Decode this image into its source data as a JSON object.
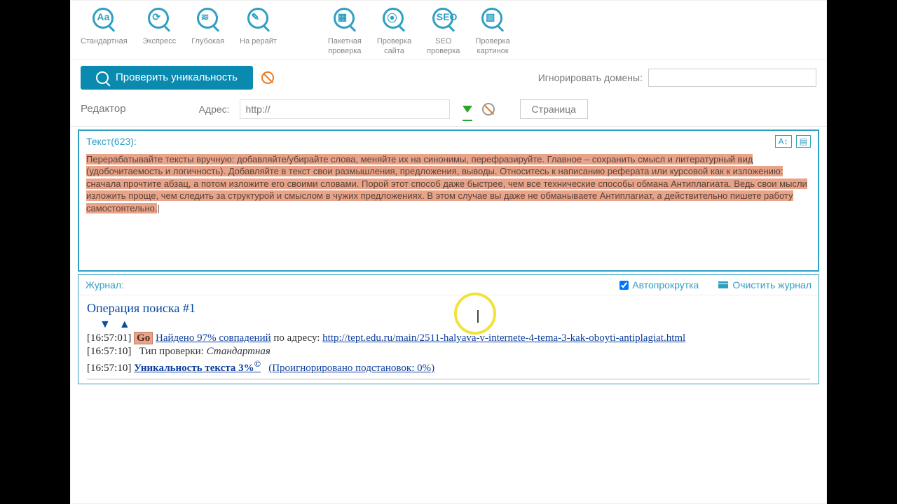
{
  "toolbar": {
    "left": [
      {
        "label": "Стандартная",
        "glyph": "Аа",
        "name": "mode-standard"
      },
      {
        "label": "Экспресс",
        "glyph": "⟳",
        "name": "mode-express"
      },
      {
        "label": "Глубокая",
        "glyph": "≋",
        "name": "mode-deep"
      },
      {
        "label": "На рерайт",
        "glyph": "✎",
        "name": "mode-rewrite"
      }
    ],
    "right": [
      {
        "label": "Пакетная\nпроверка",
        "glyph": "▦",
        "name": "batch-check"
      },
      {
        "label": "Проверка\nсайта",
        "glyph": "⦿",
        "name": "site-check"
      },
      {
        "label": "SEO\nпроверка",
        "glyph": "SEO",
        "name": "seo-check"
      },
      {
        "label": "Проверка\nкартинок",
        "glyph": "▧",
        "name": "image-check"
      }
    ]
  },
  "actions": {
    "check_label": "Проверить уникальность",
    "ignore_label": "Игнорировать домены:",
    "ignore_value": ""
  },
  "urlrow": {
    "editor_label": "Редактор",
    "addr_label": "Адрес:",
    "addr_placeholder": "http://",
    "tab_label": "Страница"
  },
  "textpanel": {
    "header": "Текст(623):",
    "content": "Перерабатывайте тексты вручную: добавляйте/убирайте слова, меняйте их на синонимы, перефразируйте. Главное – сохранить смысл и литературный вид (удобочитаемость и логичность).\nДобавляйте в текст свои размышления, предложения, выводы. Относитесь к написанию реферата или курсовой как к изложению: сначала прочтите абзац, а потом изложите его своими словами. Порой этот способ даже быстрее, чем все технические способы обмана Антиплагиата. Ведь свои мысли изложить проще, чем следить за структурой и смыслом в чужих предложениях. В этом случае вы даже не обманываете Антиплагиат, а действительно пишете работу самостоятельно."
  },
  "log": {
    "header": "Журнал:",
    "autoscroll_label": "Автопрокрутка",
    "autoscroll_checked": true,
    "clear_label": "Очистить журнал",
    "op_title": "Операция поиска #1",
    "lines": [
      {
        "ts": "[16:57:01]",
        "go": "Go",
        "found": "Найдено 97% совпадений",
        "mid": " по адресу: ",
        "url": "http://tept.edu.ru/main/2511-halyava-v-internete-4-tema-3-kak-oboyti-antiplagiat.html"
      },
      {
        "ts": "[16:57:10]",
        "type_label": "Тип проверки: ",
        "type_value": "Стандартная"
      },
      {
        "ts": "[16:57:10]",
        "uniq": "Уникальность текста 3%",
        "sup": "©",
        "ignored": "(Проигнорировано подстановок: 0%)"
      }
    ]
  }
}
